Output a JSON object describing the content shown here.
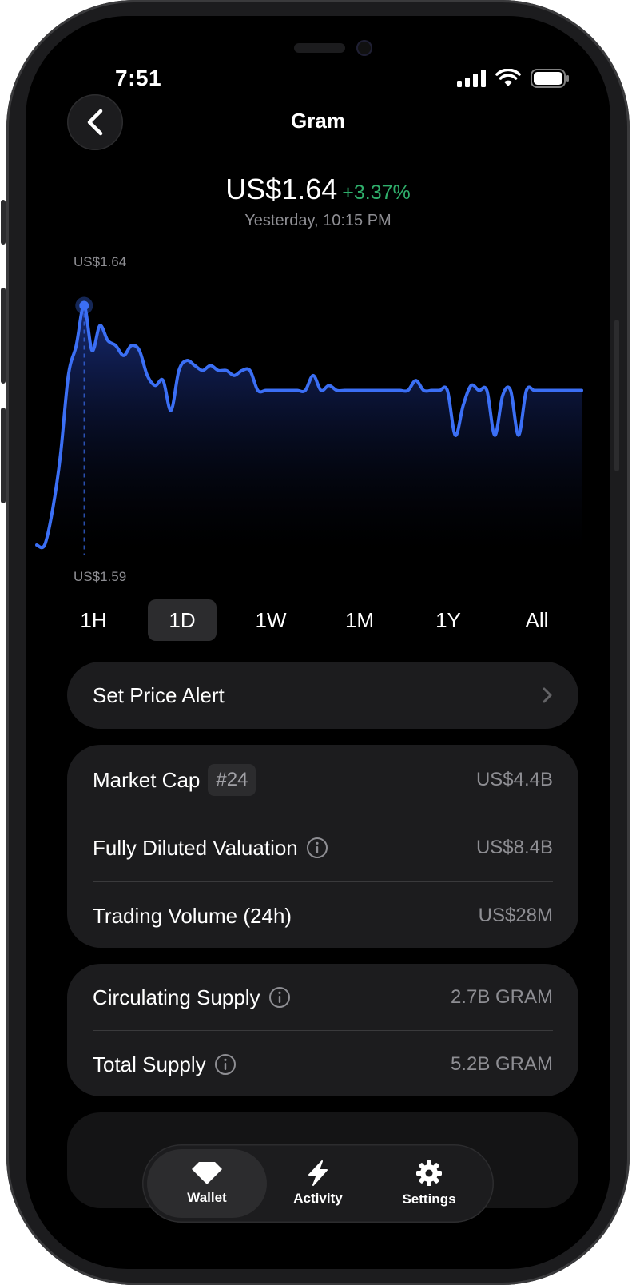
{
  "status": {
    "time": "7:51"
  },
  "header": {
    "title": "Gram"
  },
  "price": {
    "value": "US$1.64",
    "change": "+3.37%",
    "timestamp": "Yesterday, 10:15 PM"
  },
  "chart_data": {
    "type": "area",
    "high_label": "US$1.64",
    "low_label": "US$1.59",
    "ylim": [
      1.59,
      1.64
    ],
    "x": [
      0,
      1,
      2,
      3,
      4,
      5,
      6,
      7,
      8,
      9,
      10,
      11,
      12,
      13,
      14,
      15,
      16,
      17,
      18,
      19,
      20,
      21,
      22,
      23,
      24,
      25,
      26,
      27,
      28,
      29,
      30,
      31,
      32,
      33,
      34,
      35,
      36,
      37,
      38,
      39,
      40,
      41,
      42,
      43,
      44,
      45,
      46,
      47,
      48,
      49,
      50,
      51,
      52,
      53,
      54,
      55,
      56,
      57,
      58,
      59,
      60,
      61,
      62,
      63,
      64,
      65,
      66,
      67,
      68,
      69
    ],
    "values": [
      1.59,
      1.59,
      1.597,
      1.608,
      1.624,
      1.63,
      1.638,
      1.629,
      1.634,
      1.631,
      1.63,
      1.628,
      1.63,
      1.629,
      1.624,
      1.622,
      1.623,
      1.617,
      1.625,
      1.627,
      1.626,
      1.625,
      1.626,
      1.625,
      1.625,
      1.624,
      1.625,
      1.625,
      1.621,
      1.621,
      1.621,
      1.621,
      1.621,
      1.621,
      1.621,
      1.624,
      1.621,
      1.622,
      1.621,
      1.621,
      1.621,
      1.621,
      1.621,
      1.621,
      1.621,
      1.621,
      1.621,
      1.621,
      1.623,
      1.621,
      1.621,
      1.621,
      1.621,
      1.612,
      1.618,
      1.622,
      1.621,
      1.621,
      1.612,
      1.62,
      1.621,
      1.612,
      1.621,
      1.621,
      1.621,
      1.621,
      1.621,
      1.621,
      1.621,
      1.621
    ],
    "highlight_index": 6,
    "color": "#3b6ff5"
  },
  "periods": [
    "1H",
    "1D",
    "1W",
    "1M",
    "1Y",
    "All"
  ],
  "active_period": "1D",
  "alert": {
    "label": "Set Price Alert"
  },
  "market": {
    "market_cap_label": "Market Cap",
    "rank": "#24",
    "market_cap_value": "US$4.4B",
    "fdv_label": "Fully Diluted Valuation",
    "fdv_value": "US$8.4B",
    "volume_label": "Trading Volume (24h)",
    "volume_value": "US$28M"
  },
  "supply": {
    "circulating_label": "Circulating Supply",
    "circulating_value": "2.7B GRAM",
    "total_label": "Total Supply",
    "total_value": "5.2B GRAM"
  },
  "tabbar": {
    "wallet": "Wallet",
    "activity": "Activity",
    "settings": "Settings"
  }
}
